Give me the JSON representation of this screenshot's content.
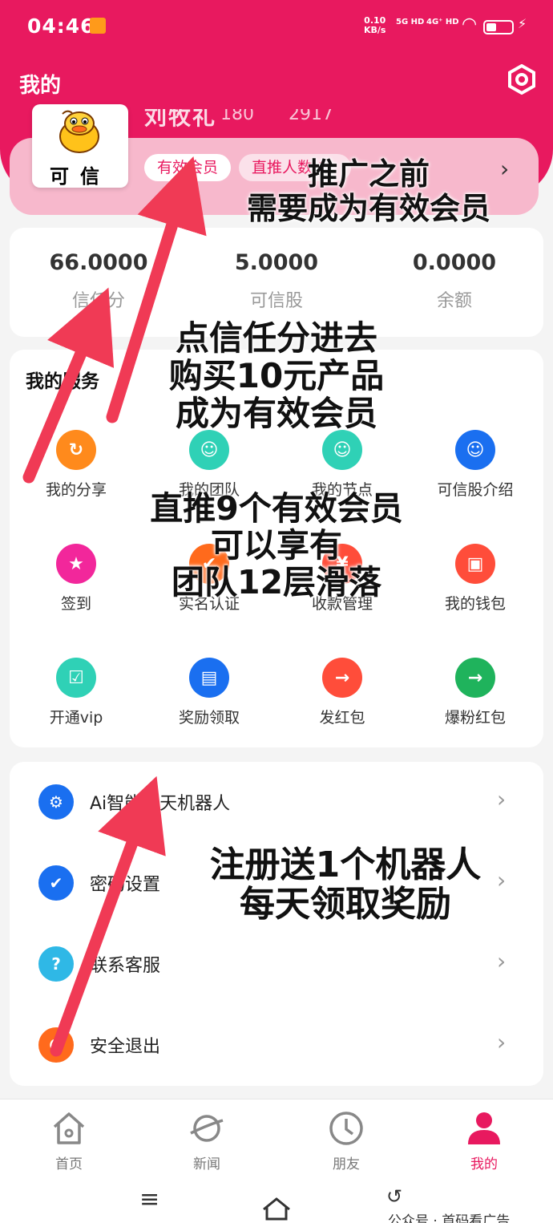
{
  "status_bar": {
    "time": "04:46",
    "speed_value": "0.10",
    "speed_unit": "KB/s",
    "signal1": "5G HD",
    "signal2": "4G⁺ HD",
    "icons": [
      "notification-icon",
      "signal-icon",
      "wifi-icon",
      "battery-icon",
      "charging-icon"
    ]
  },
  "header": {
    "title": "我的",
    "settings_icon": "settings-hex-icon"
  },
  "profile": {
    "name": "刘牧礼",
    "id": "180",
    "count": "2917",
    "avatar_text": "可信",
    "badge_member": "有效会员",
    "badge_direct": "直推人数:1"
  },
  "stats": [
    {
      "value": "66.0000",
      "label": "信任分"
    },
    {
      "value": "5.0000",
      "label": "可信股"
    },
    {
      "value": "0.0000",
      "label": "余额"
    }
  ],
  "services": {
    "title": "我的服务",
    "items": [
      {
        "label": "我的分享",
        "icon": "share-icon",
        "color": "#ff8a1c"
      },
      {
        "label": "我的团队",
        "icon": "team-icon",
        "color": "#2fd1b6"
      },
      {
        "label": "我的节点",
        "icon": "node-icon",
        "color": "#2fd1b6"
      },
      {
        "label": "可信股介绍",
        "icon": "shares-intro-icon",
        "color": "#1a6ff0"
      },
      {
        "label": "签到",
        "icon": "trophy-icon",
        "color": "#f2279b"
      },
      {
        "label": "实名认证",
        "icon": "id-verify-icon",
        "color": "#ff6a1c"
      },
      {
        "label": "收款管理",
        "icon": "payment-icon",
        "color": "#ff4d3a"
      },
      {
        "label": "我的钱包",
        "icon": "wallet-icon",
        "color": "#ff4d3a"
      },
      {
        "label": "开通vip",
        "icon": "vip-icon",
        "color": "#2fd1b6"
      },
      {
        "label": "奖励领取",
        "icon": "reward-card-icon",
        "color": "#1a6ff0"
      },
      {
        "label": "发红包",
        "icon": "send-redpacket-icon",
        "color": "#ff4d3a"
      },
      {
        "label": "爆粉红包",
        "icon": "enter-arrow-icon",
        "color": "#1fb35c"
      }
    ]
  },
  "menu": [
    {
      "label": "Ai智能聊天机器人",
      "icon": "chip-icon",
      "color": "#1a6ff0"
    },
    {
      "label": "密码设置",
      "icon": "shield-icon",
      "color": "#1a6ff0"
    },
    {
      "label": "联系客服",
      "icon": "help-icon",
      "color": "#2fb8e6"
    },
    {
      "label": "安全退出",
      "icon": "power-icon",
      "color": "#ff6a1c"
    }
  ],
  "tabs": [
    {
      "label": "首页",
      "icon": "home-icon"
    },
    {
      "label": "新闻",
      "icon": "planet-icon"
    },
    {
      "label": "朋友",
      "icon": "clock-icon"
    },
    {
      "label": "我的",
      "icon": "user-icon"
    }
  ],
  "active_tab": "我的",
  "nav_icons": [
    "menu-lines-icon",
    "home-outline-icon",
    "back-icon"
  ],
  "watermark": "公众号 · 首码看广告",
  "annotations": {
    "promote_1": "推广之前",
    "promote_2": "需要成为有效会员",
    "trust_1": "点信任分进去",
    "trust_2": "购买10元产品",
    "trust_3": "成为有效会员",
    "direct_1": "直推9个有效会员",
    "direct_2": "可以享有",
    "direct_3": "团队12层滑落",
    "robot_1": "注册送1个机器人",
    "robot_2": "每天领取奖励"
  },
  "colors": {
    "brand": "#e8195f",
    "arrow": "#f03a55",
    "pink_card": "#f7b8cc"
  }
}
